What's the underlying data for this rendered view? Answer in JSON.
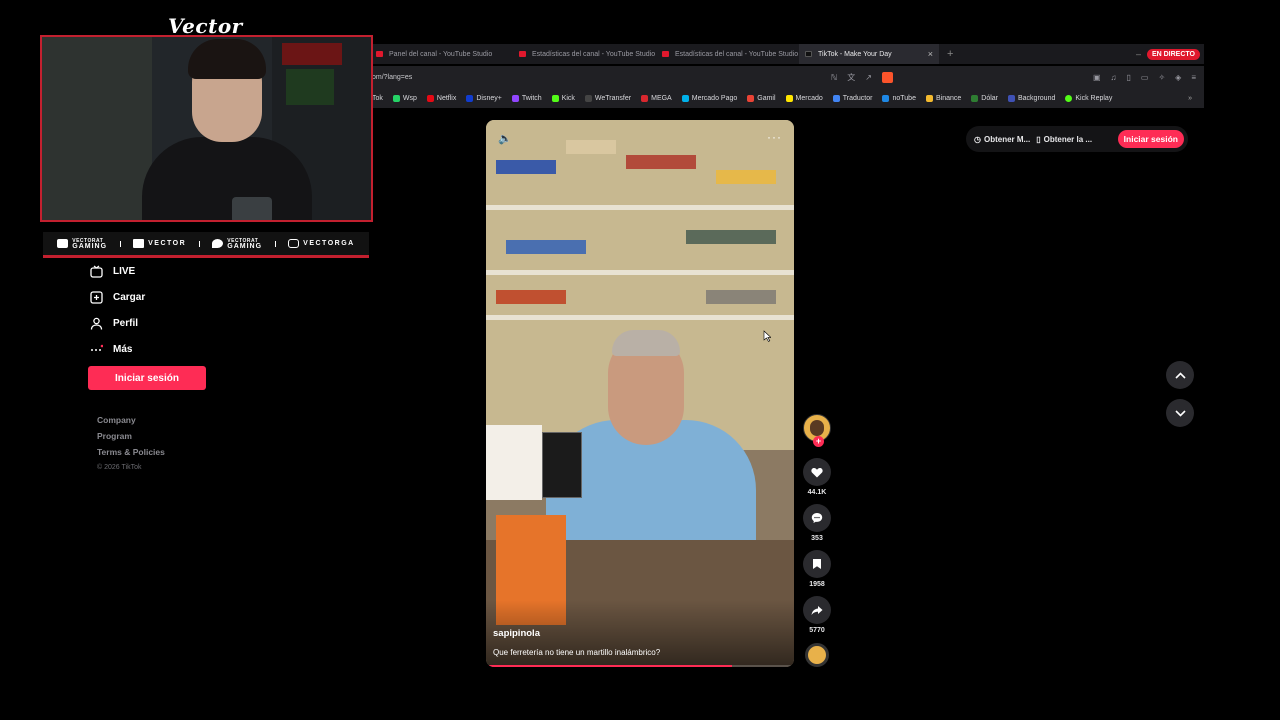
{
  "browser": {
    "tabs": [
      {
        "label": "Panel del canal - YouTube Studio",
        "active": false
      },
      {
        "label": "Estadísticas del canal - YouTube Studio",
        "active": false
      },
      {
        "label": "Estadísticas del canal - YouTube Studio",
        "active": false
      },
      {
        "label": "TikTok - Make Your Day",
        "active": true
      }
    ],
    "live_badge": "EN DIRECTO",
    "url": "om/?lang=es",
    "bookmarks": [
      {
        "label": "Tok",
        "color": "#111111"
      },
      {
        "label": "Wsp",
        "color": "#25d366"
      },
      {
        "label": "Netflix",
        "color": "#e50914"
      },
      {
        "label": "Disney+",
        "color": "#113ccf"
      },
      {
        "label": "Twitch",
        "color": "#9146ff"
      },
      {
        "label": "Kick",
        "color": "#53fc18"
      },
      {
        "label": "WeTransfer",
        "color": "#222222"
      },
      {
        "label": "MEGA",
        "color": "#d9272e"
      },
      {
        "label": "Mercado Pago",
        "color": "#00b1ea"
      },
      {
        "label": "Gamil",
        "color": "#ea4335"
      },
      {
        "label": "Mercado",
        "color": "#ffe600"
      },
      {
        "label": "Traductor",
        "color": "#4285f4"
      },
      {
        "label": "noTube",
        "color": "#1e88e5"
      },
      {
        "label": "Binance",
        "color": "#f3ba2f"
      },
      {
        "label": "Dólar",
        "color": "#2e7d32"
      },
      {
        "label": "Background",
        "color": "#3f51b5"
      },
      {
        "label": "Kick Replay",
        "color": "#53fc18"
      }
    ]
  },
  "overlay": {
    "brand": "Vector",
    "socials": [
      {
        "icon": "youtube-icon",
        "top": "VECTORAT",
        "label": "GAMING"
      },
      {
        "icon": "twitch-icon",
        "top": "",
        "label": "VECTOR"
      },
      {
        "icon": "twitter-icon",
        "top": "VECTORAT",
        "label": "GAMING"
      },
      {
        "icon": "instagram-icon",
        "top": "",
        "label": "VECTORGA"
      }
    ]
  },
  "sidebar": {
    "items": [
      {
        "label": "LIVE",
        "icon": "live-tv-icon"
      },
      {
        "label": "Cargar",
        "icon": "upload-plus-icon"
      },
      {
        "label": "Perfil",
        "icon": "person-icon"
      },
      {
        "label": "Más",
        "icon": "more-dots-icon"
      }
    ],
    "login_label": "Iniciar sesión",
    "footer": [
      "Company",
      "Program",
      "Terms & Policies"
    ],
    "copyright": "© 2026 TikTok"
  },
  "video": {
    "username": "sapipinola",
    "caption": "Que ferretería no tiene un martillo inalámbrico?",
    "progress": 0.8
  },
  "actions": {
    "likes": "44.1K",
    "comments": "353",
    "saves": "1958",
    "shares": "5770"
  },
  "topbar": {
    "get_app_label": "Obtener M...",
    "get_desktop_label": "Obtener la ...",
    "login_label": "Iniciar sesión"
  },
  "colors": {
    "accent": "#fe2c55",
    "overlay_red": "#c3202f"
  }
}
